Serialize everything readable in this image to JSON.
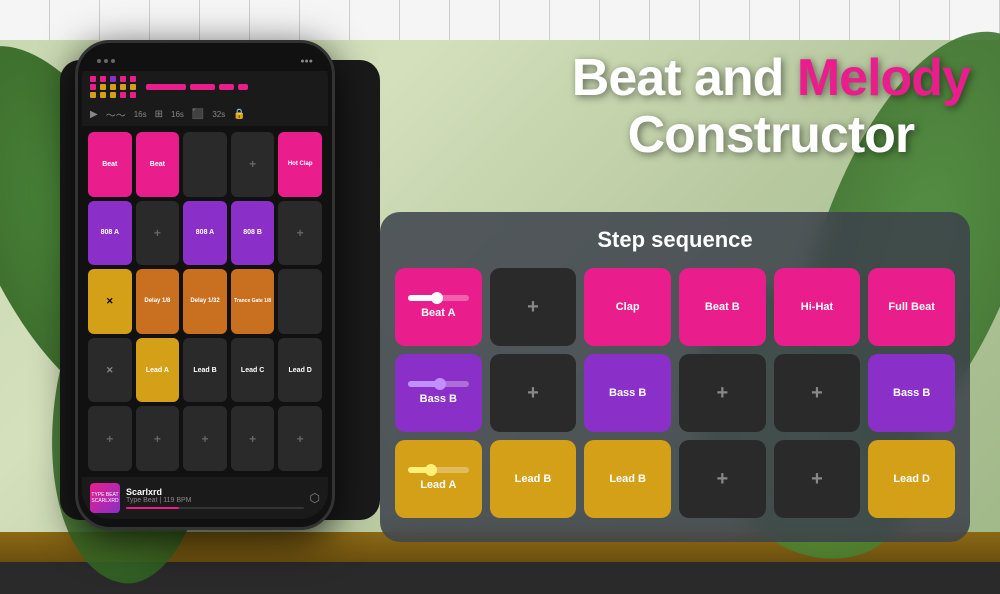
{
  "background": {
    "color": "#c8d8b0"
  },
  "title": {
    "line1_part1": "Beat and ",
    "line1_melody": "Melody",
    "line2": "Constructor"
  },
  "phone": {
    "artist": "Scarlxrd",
    "track": "Type Beat | 119 BPM",
    "footer_label1": "TYPE BEAT",
    "footer_label2": "SCARLXRD",
    "pads": [
      {
        "label": "Beat",
        "color": "pink"
      },
      {
        "label": "Beat",
        "color": "pink"
      },
      {
        "label": "",
        "color": "dark"
      },
      {
        "label": "+",
        "color": "dark"
      },
      {
        "label": "Hot Clap",
        "color": "pink"
      },
      {
        "label": "808 A",
        "color": "purple"
      },
      {
        "label": "+",
        "color": "dark"
      },
      {
        "label": "808 A",
        "color": "purple"
      },
      {
        "label": "808 B",
        "color": "purple"
      },
      {
        "label": "+",
        "color": "dark"
      },
      {
        "label": "X",
        "color": "yellow"
      },
      {
        "label": "Delay 1/8",
        "color": "orange"
      },
      {
        "label": "Delay 1/32",
        "color": "orange"
      },
      {
        "label": "Trance Gate 1/8",
        "color": "orange"
      },
      {
        "label": "",
        "color": "dark"
      },
      {
        "label": "X",
        "color": "dark"
      },
      {
        "label": "Lead A",
        "color": "yellow"
      },
      {
        "label": "Lead B",
        "color": "dark"
      },
      {
        "label": "Lead C",
        "color": "dark"
      },
      {
        "label": "Lead D",
        "color": "dark"
      },
      {
        "label": "+",
        "color": "dark"
      },
      {
        "label": "+",
        "color": "dark"
      },
      {
        "label": "+",
        "color": "dark"
      },
      {
        "label": "+",
        "color": "dark"
      },
      {
        "label": "+",
        "color": "dark"
      }
    ]
  },
  "step_sequence": {
    "title": "Step sequence",
    "rows": [
      [
        {
          "label": "Beat A",
          "color": "pink",
          "has_slider": true
        },
        {
          "label": "+",
          "color": "dark"
        },
        {
          "label": "Clap",
          "color": "pink"
        },
        {
          "label": "Beat B",
          "color": "pink"
        },
        {
          "label": "Hi-Hat",
          "color": "pink"
        },
        {
          "label": "Full Beat",
          "color": "pink"
        }
      ],
      [
        {
          "label": "Bass B",
          "color": "purple",
          "has_slider": true
        },
        {
          "label": "+",
          "color": "dark"
        },
        {
          "label": "Bass B",
          "color": "purple"
        },
        {
          "label": "+",
          "color": "dark"
        },
        {
          "label": "+",
          "color": "dark"
        },
        {
          "label": "Bass B",
          "color": "purple"
        }
      ],
      [
        {
          "label": "Lead A",
          "color": "yellow",
          "has_slider": true
        },
        {
          "label": "Lead B",
          "color": "yellow"
        },
        {
          "label": "Lead B",
          "color": "yellow"
        },
        {
          "label": "+",
          "color": "dark"
        },
        {
          "label": "+",
          "color": "dark"
        },
        {
          "label": "Lead D",
          "color": "yellow"
        }
      ]
    ]
  }
}
